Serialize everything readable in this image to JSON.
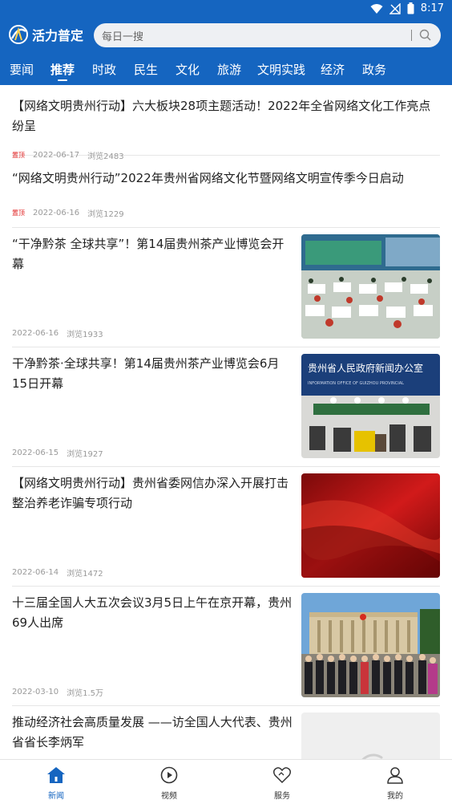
{
  "status": {
    "time": "8:17"
  },
  "header": {
    "logo_text": "活力普定",
    "search_placeholder": "每日一搜"
  },
  "tabs": [
    {
      "label": "要闻"
    },
    {
      "label": "推荐"
    },
    {
      "label": "时政"
    },
    {
      "label": "民生"
    },
    {
      "label": "文化"
    },
    {
      "label": "旅游"
    },
    {
      "label": "文明实践"
    },
    {
      "label": "经济"
    },
    {
      "label": "政务"
    }
  ],
  "active_tab": "推荐",
  "feed": [
    {
      "title": "【网络文明贵州行动】六大板块28项主题活动！2022年全省网络文化工作亮点纷呈",
      "badge": "置顶",
      "date": "2022-06-17",
      "views": "浏览2483",
      "thumb": null
    },
    {
      "title": "“网络文明贵州行动”2022年贵州省网络文化节暨网络文明宣传季今日启动",
      "badge": "置顶",
      "date": "2022-06-16",
      "views": "浏览1229",
      "thumb": null
    },
    {
      "title": "“干净黔茶 全球共享”！第14届贵州茶产业博览会开幕",
      "badge": "",
      "date": "2022-06-16",
      "views": "浏览1933",
      "thumb": "expo-hall-photo"
    },
    {
      "title": "干净黔茶·全球共享！第14届贵州茶产业博览会6月15日开幕",
      "badge": "",
      "date": "2022-06-15",
      "views": "浏览1927",
      "thumb": "press-conference-photo"
    },
    {
      "title": "【网络文明贵州行动】贵州省委网信办深入开展打击整治养老诈骗专项行动",
      "badge": "",
      "date": "2022-06-14",
      "views": "浏览1472",
      "thumb": "red-flag-photo"
    },
    {
      "title": "十三届全国人大五次会议3月5日上午在京开幕，贵州69人出席",
      "badge": "",
      "date": "2022-03-10",
      "views": "浏览1.5万",
      "thumb": "great-hall-group-photo"
    },
    {
      "title": "推动经济社会高质量发展 ——访全国人大代表、贵州省省长李炳军",
      "badge": "",
      "date": "",
      "views": "",
      "thumb": "loading-placeholder"
    }
  ],
  "bottom_nav": [
    {
      "label": "新闻",
      "icon": "home-icon",
      "active": true
    },
    {
      "label": "视频",
      "icon": "play-icon",
      "active": false
    },
    {
      "label": "服务",
      "icon": "heart-icon",
      "active": false
    },
    {
      "label": "我的",
      "icon": "user-icon",
      "active": false
    }
  ],
  "colors": {
    "brand": "#1565c0",
    "badge": "#e02020",
    "meta": "#999999"
  }
}
